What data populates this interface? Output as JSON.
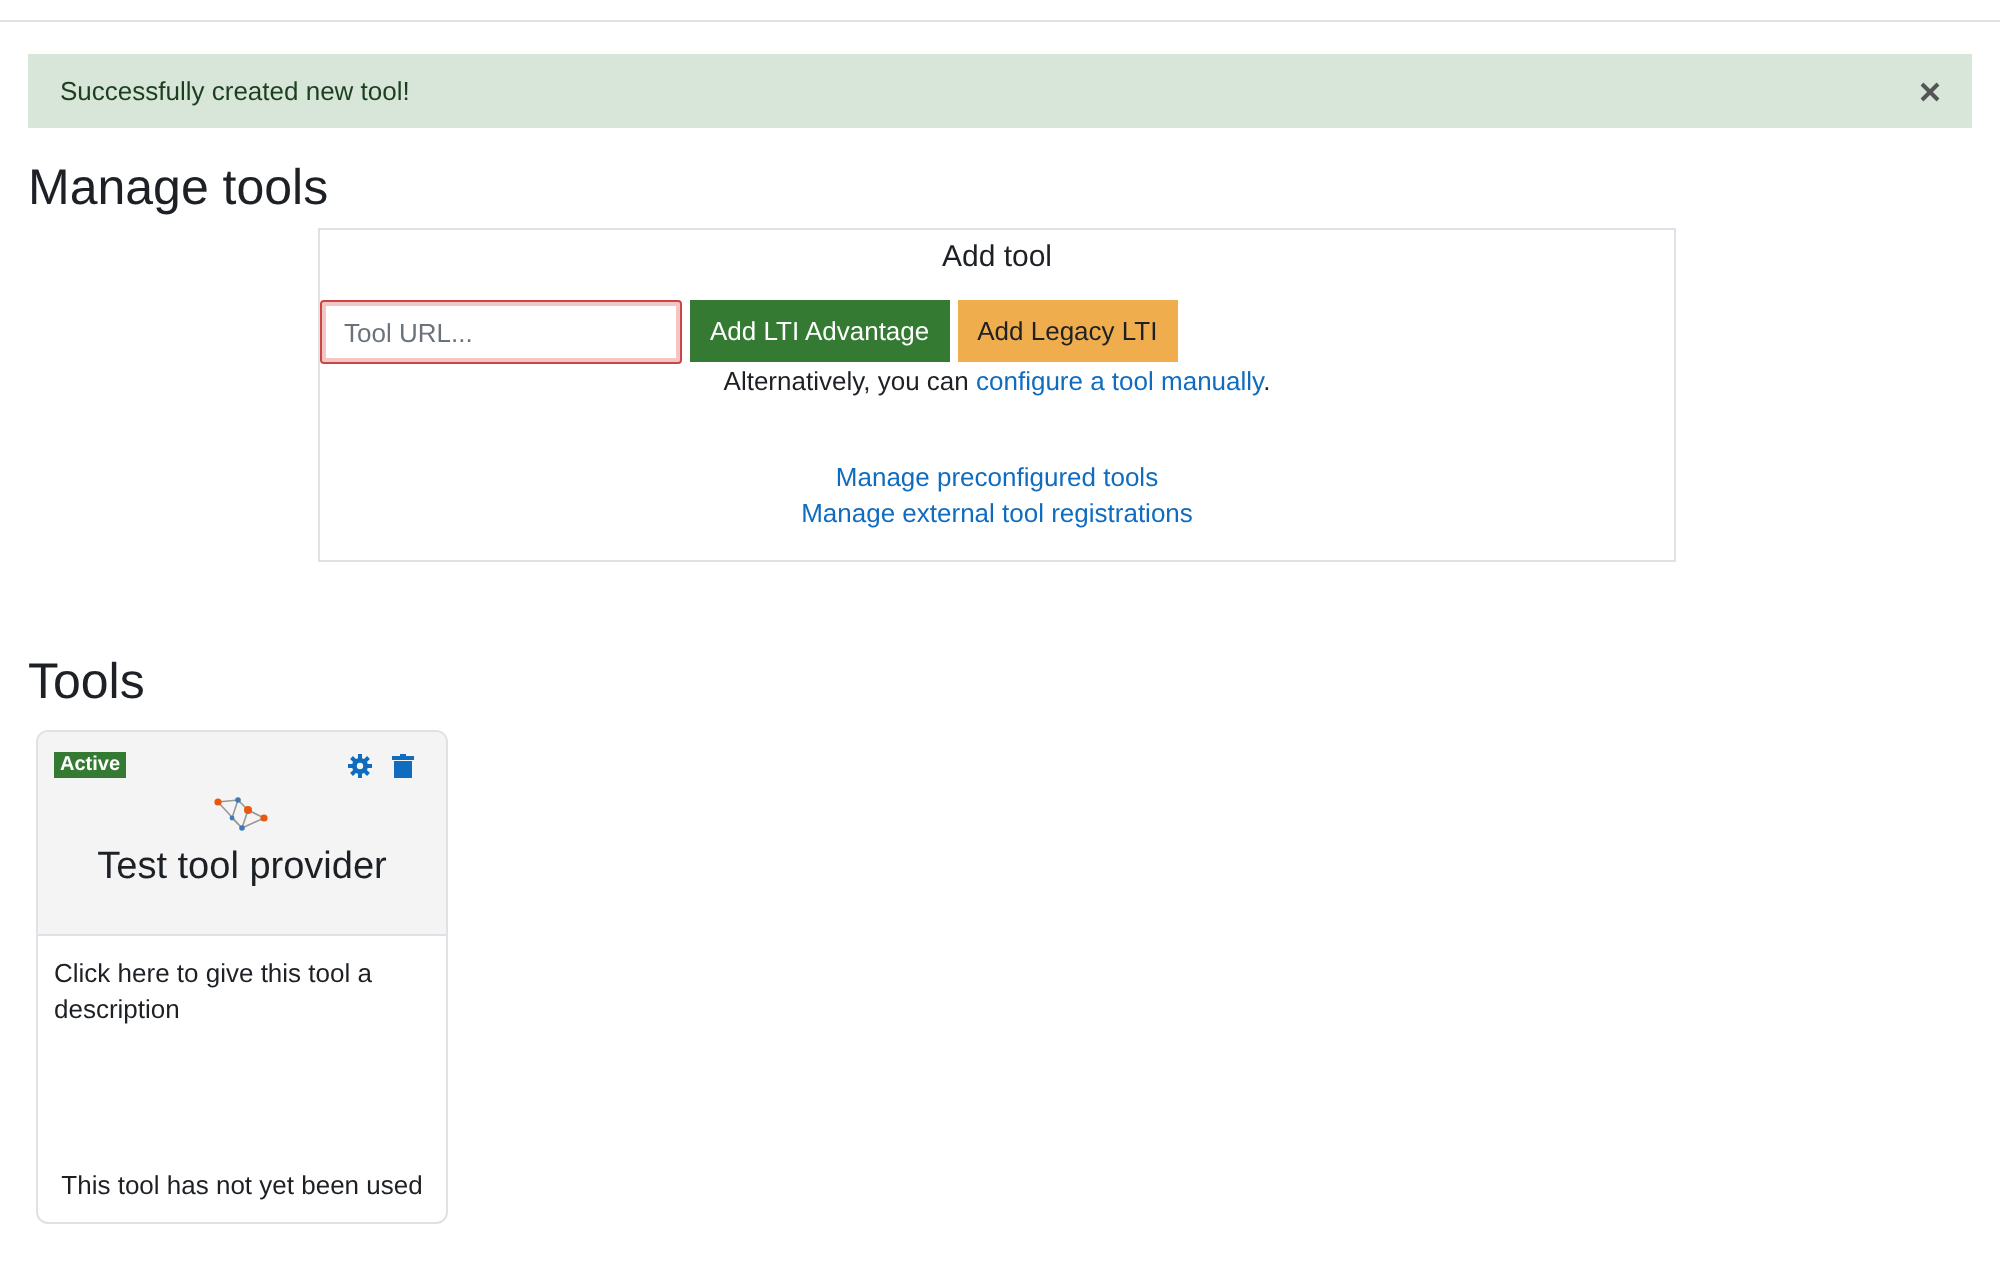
{
  "alert": {
    "message": "Successfully created new tool!"
  },
  "heading": "Manage tools",
  "add_tool": {
    "title": "Add tool",
    "url_field": {
      "placeholder": "Tool URL..."
    },
    "buttons": [
      {
        "label": "Add LTI Advantage",
        "kind": "primary"
      },
      {
        "label": "Add Legacy LTI",
        "kind": "warning"
      }
    ],
    "alternative": {
      "text": "Alternatively, you can ",
      "link": "configure a tool manually",
      "after": "."
    },
    "links": [
      "Manage preconfigured tools",
      "Manage external tool registrations"
    ]
  },
  "tools_heading": "Tools",
  "tools": [
    {
      "status": "Active",
      "name": "Test tool provider",
      "description": "Click here to give this tool a description",
      "usage": "This tool has not yet been used"
    }
  ]
}
